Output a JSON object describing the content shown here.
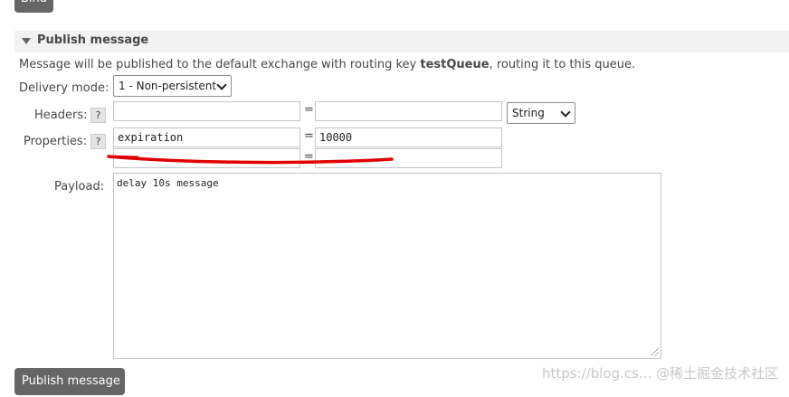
{
  "bind_button": {
    "label": "Bind"
  },
  "section": {
    "title": "Publish message"
  },
  "intro": {
    "prefix": "Message will be published to the default exchange with routing key ",
    "routing_key": "testQueue",
    "suffix": ", routing it to this queue."
  },
  "delivery_mode": {
    "label": "Delivery mode:",
    "selected": "1 - Non-persistent"
  },
  "headers": {
    "label": "Headers:",
    "help": "?",
    "key": "",
    "value": "",
    "type_selected": "String",
    "equals": "="
  },
  "properties": {
    "label": "Properties:",
    "help": "?",
    "rows": [
      {
        "key": "expiration",
        "value": "10000",
        "equals": "="
      },
      {
        "key": "",
        "value": "",
        "equals": "="
      }
    ]
  },
  "payload": {
    "label": "Payload:",
    "value": "delay 10s message"
  },
  "publish_button": {
    "label": "Publish message"
  },
  "watermark": {
    "text": "https://blog.cs... @稀土掘金技术社区"
  },
  "colors": {
    "annotation_red": "#e00000",
    "button_bg": "#666666",
    "section_bg": "#f2f2f2"
  }
}
